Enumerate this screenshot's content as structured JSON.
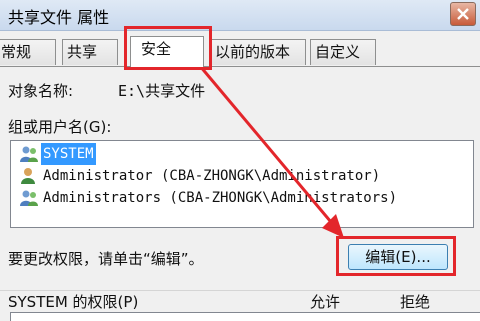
{
  "window": {
    "title": "共享文件 属性"
  },
  "tabs": [
    {
      "label": "常规"
    },
    {
      "label": "共享"
    },
    {
      "label": "安全"
    },
    {
      "label": "以前的版本"
    },
    {
      "label": "自定义"
    }
  ],
  "security": {
    "object_label": "对象名称:",
    "object_value": "E:\\共享文件",
    "group_label": "组或用户名(G):",
    "principals": [
      {
        "name": "SYSTEM",
        "selected": true,
        "icon": "user-group-icon"
      },
      {
        "name": "Administrator  (CBA-ZHONGK\\Administrator)",
        "selected": false,
        "icon": "user-icon"
      },
      {
        "name": "Administrators  (CBA-ZHONGK\\Administrators)",
        "selected": false,
        "icon": "user-group-icon"
      }
    ],
    "change_hint": "要更改权限，请单击“编辑”。",
    "edit_button": "编辑(E)...",
    "perm_label": "SYSTEM 的权限(P)",
    "allow_col": "允许",
    "deny_col": "拒绝"
  },
  "colors": {
    "annotation": "#e3262b",
    "selection": "#3399ff"
  }
}
